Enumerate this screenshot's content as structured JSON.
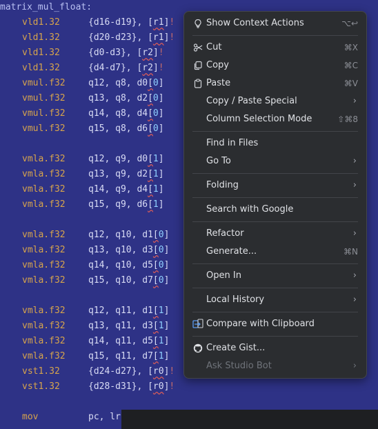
{
  "editor": {
    "label": "matrix_mul_float:",
    "lines": [
      {
        "mn": "vld1.32",
        "ops": [
          {
            "t": "{d16-d19}, ",
            "c": ""
          },
          {
            "t": "[",
            "c": ""
          },
          {
            "t": "r1",
            "c": "sq"
          },
          {
            "t": "]",
            "c": ""
          },
          {
            "t": "!",
            "c": "bang"
          }
        ]
      },
      {
        "mn": "vld1.32",
        "ops": [
          {
            "t": "{d20-d23}, ",
            "c": ""
          },
          {
            "t": "[",
            "c": ""
          },
          {
            "t": "r1",
            "c": "sq"
          },
          {
            "t": "]",
            "c": ""
          },
          {
            "t": "!",
            "c": "bang"
          }
        ]
      },
      {
        "mn": "vld1.32",
        "ops": [
          {
            "t": "{d0-d3}, ",
            "c": ""
          },
          {
            "t": "[",
            "c": ""
          },
          {
            "t": "r2",
            "c": "sq"
          },
          {
            "t": "]",
            "c": ""
          },
          {
            "t": "!",
            "c": "bang"
          }
        ]
      },
      {
        "mn": "vld1.32",
        "ops": [
          {
            "t": "{d4-d7}, ",
            "c": ""
          },
          {
            "t": "[",
            "c": ""
          },
          {
            "t": "r2",
            "c": "sq"
          },
          {
            "t": "]",
            "c": ""
          },
          {
            "t": "!",
            "c": "bang"
          }
        ]
      },
      {
        "mn": "vmul.f32",
        "ops": [
          {
            "t": "q12, q8, d0",
            "c": ""
          },
          {
            "t": "[",
            "c": "sq"
          },
          {
            "t": "0",
            "c": "reg"
          },
          {
            "t": "]",
            "c": ""
          }
        ]
      },
      {
        "mn": "vmul.f32",
        "ops": [
          {
            "t": "q13, q8, d2",
            "c": ""
          },
          {
            "t": "[",
            "c": "sq"
          },
          {
            "t": "0",
            "c": "reg"
          },
          {
            "t": "]",
            "c": ""
          }
        ]
      },
      {
        "mn": "vmul.f32",
        "ops": [
          {
            "t": "q14, q8, d4",
            "c": ""
          },
          {
            "t": "[",
            "c": "sq"
          },
          {
            "t": "0",
            "c": "reg"
          },
          {
            "t": "]",
            "c": ""
          }
        ]
      },
      {
        "mn": "vmul.f32",
        "ops": [
          {
            "t": "q15, q8, d6",
            "c": ""
          },
          {
            "t": "[",
            "c": "sq"
          },
          {
            "t": "0",
            "c": "reg"
          },
          {
            "t": "]",
            "c": ""
          }
        ]
      },
      null,
      {
        "mn": "vmla.f32",
        "ops": [
          {
            "t": "q12, q9, d0",
            "c": ""
          },
          {
            "t": "[",
            "c": "sq"
          },
          {
            "t": "1",
            "c": "reg"
          },
          {
            "t": "]",
            "c": ""
          }
        ]
      },
      {
        "mn": "vmla.f32",
        "ops": [
          {
            "t": "q13, q9, d2",
            "c": ""
          },
          {
            "t": "[",
            "c": "sq"
          },
          {
            "t": "1",
            "c": "reg"
          },
          {
            "t": "]",
            "c": ""
          }
        ]
      },
      {
        "mn": "vmla.f32",
        "ops": [
          {
            "t": "q14, q9, d4",
            "c": ""
          },
          {
            "t": "[",
            "c": "sq"
          },
          {
            "t": "1",
            "c": "reg"
          },
          {
            "t": "]",
            "c": ""
          }
        ]
      },
      {
        "mn": "vmla.f32",
        "ops": [
          {
            "t": "q15, q9, d6",
            "c": ""
          },
          {
            "t": "[",
            "c": "sq"
          },
          {
            "t": "1",
            "c": "reg"
          },
          {
            "t": "]",
            "c": ""
          }
        ]
      },
      null,
      {
        "mn": "vmla.f32",
        "ops": [
          {
            "t": "q12, q10, d1",
            "c": ""
          },
          {
            "t": "[",
            "c": "sq"
          },
          {
            "t": "0",
            "c": "reg"
          },
          {
            "t": "]",
            "c": ""
          }
        ]
      },
      {
        "mn": "vmla.f32",
        "ops": [
          {
            "t": "q13, q10, d3",
            "c": ""
          },
          {
            "t": "[",
            "c": "sq"
          },
          {
            "t": "0",
            "c": "reg"
          },
          {
            "t": "]",
            "c": ""
          }
        ]
      },
      {
        "mn": "vmla.f32",
        "ops": [
          {
            "t": "q14, q10, d5",
            "c": ""
          },
          {
            "t": "[",
            "c": "sq"
          },
          {
            "t": "0",
            "c": "reg"
          },
          {
            "t": "]",
            "c": ""
          }
        ]
      },
      {
        "mn": "vmla.f32",
        "ops": [
          {
            "t": "q15, q10, d7",
            "c": ""
          },
          {
            "t": "[",
            "c": "sq"
          },
          {
            "t": "0",
            "c": "reg"
          },
          {
            "t": "]",
            "c": ""
          }
        ]
      },
      null,
      {
        "mn": "vmla.f32",
        "ops": [
          {
            "t": "q12, q11, d1",
            "c": ""
          },
          {
            "t": "[",
            "c": "sq"
          },
          {
            "t": "1",
            "c": "reg"
          },
          {
            "t": "]",
            "c": ""
          }
        ]
      },
      {
        "mn": "vmla.f32",
        "ops": [
          {
            "t": "q13, q11, d3",
            "c": ""
          },
          {
            "t": "[",
            "c": "sq"
          },
          {
            "t": "1",
            "c": "reg"
          },
          {
            "t": "]",
            "c": ""
          }
        ]
      },
      {
        "mn": "vmla.f32",
        "ops": [
          {
            "t": "q14, q11, d5",
            "c": ""
          },
          {
            "t": "[",
            "c": "sq"
          },
          {
            "t": "1",
            "c": "reg"
          },
          {
            "t": "]",
            "c": ""
          }
        ]
      },
      {
        "mn": "vmla.f32",
        "ops": [
          {
            "t": "q15, q11, d7",
            "c": ""
          },
          {
            "t": "[",
            "c": "sq"
          },
          {
            "t": "1",
            "c": "reg"
          },
          {
            "t": "]",
            "c": ""
          }
        ]
      },
      {
        "mn": "vst1.32",
        "ops": [
          {
            "t": "{d24-d27}, ",
            "c": ""
          },
          {
            "t": "[",
            "c": ""
          },
          {
            "t": "r0",
            "c": "sq"
          },
          {
            "t": "]",
            "c": ""
          },
          {
            "t": "!",
            "c": "bang"
          }
        ]
      },
      {
        "mn": "vst1.32",
        "ops": [
          {
            "t": "{d28-d31}, ",
            "c": ""
          },
          {
            "t": "[",
            "c": ""
          },
          {
            "t": "r0",
            "c": "sq"
          },
          {
            "t": "]",
            "c": ""
          },
          {
            "t": "!",
            "c": "bang"
          }
        ]
      },
      null,
      {
        "mn": "mov",
        "ops": [
          {
            "t": "pc, lr",
            "c": ""
          }
        ]
      }
    ]
  },
  "context_menu": {
    "items": [
      {
        "label": "Show Context Actions",
        "shortcut": "⌥↩",
        "icon": "lightbulb-icon"
      },
      {
        "sep": true
      },
      {
        "label": "Cut",
        "shortcut": "⌘X",
        "icon": "scissors-icon"
      },
      {
        "label": "Copy",
        "shortcut": "⌘C",
        "icon": "copy-icon"
      },
      {
        "label": "Paste",
        "shortcut": "⌘V",
        "icon": "paste-icon"
      },
      {
        "label": "Copy / Paste Special",
        "submenu": true
      },
      {
        "label": "Column Selection Mode",
        "shortcut": "⇧⌘8"
      },
      {
        "sep": true
      },
      {
        "label": "Find in Files"
      },
      {
        "label": "Go To",
        "submenu": true
      },
      {
        "sep": true
      },
      {
        "label": "Folding",
        "submenu": true
      },
      {
        "sep": true
      },
      {
        "label": "Search with Google"
      },
      {
        "sep": true
      },
      {
        "label": "Refactor",
        "submenu": true
      },
      {
        "label": "Generate...",
        "shortcut": "⌘N"
      },
      {
        "sep": true
      },
      {
        "label": "Open In",
        "submenu": true
      },
      {
        "sep": true
      },
      {
        "label": "Local History",
        "submenu": true
      },
      {
        "sep": true
      },
      {
        "label": "Compare with Clipboard",
        "icon": "compare-icon"
      },
      {
        "sep": true
      },
      {
        "label": "Create Gist...",
        "icon": "github-icon"
      },
      {
        "label": "Ask Studio Bot",
        "submenu": true,
        "disabled": true
      }
    ]
  }
}
